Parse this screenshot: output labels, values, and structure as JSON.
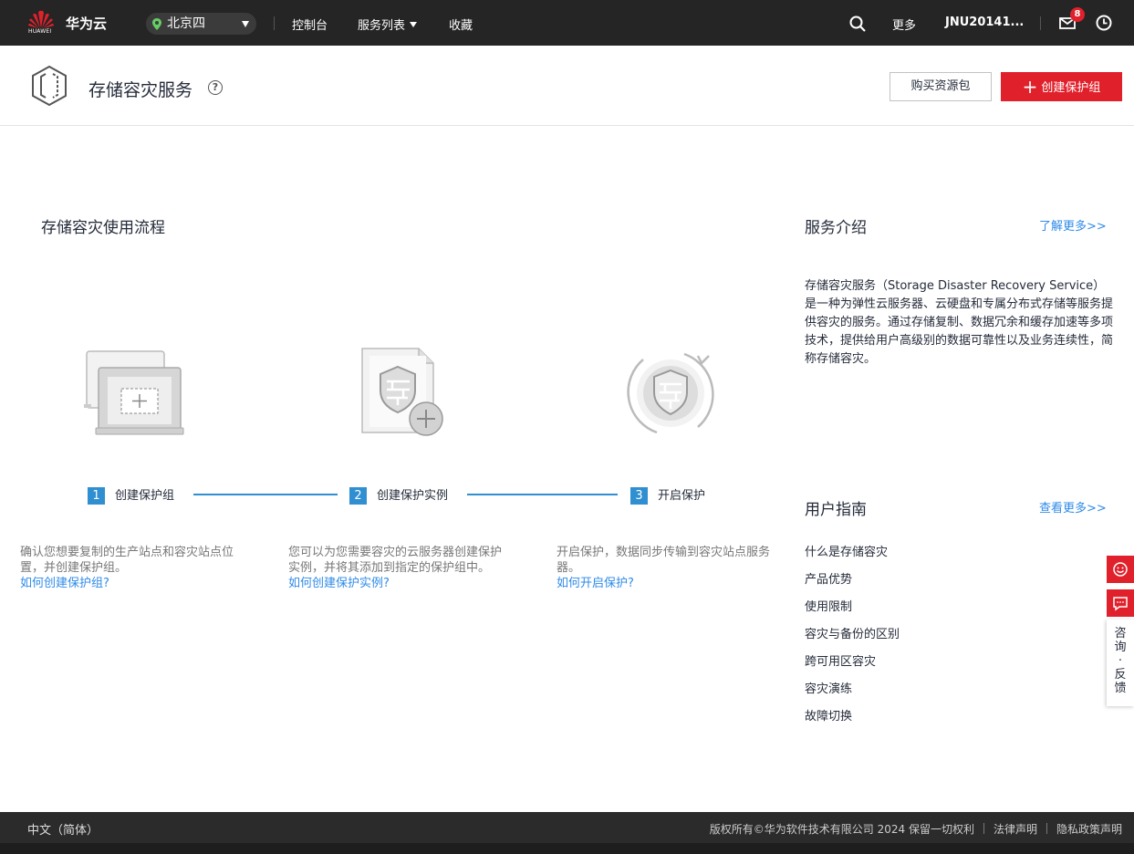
{
  "topbar": {
    "logo_text": "HUAWEI",
    "brand": "华为云",
    "region": "北京四",
    "nav": [
      "控制台",
      "服务列表",
      "收藏"
    ],
    "more": "更多",
    "user": "JNU20141...",
    "message_count": "8"
  },
  "header": {
    "title": "存储容灾服务",
    "help": "?",
    "buy_button": "购买资源包",
    "create_button": "创建保护组"
  },
  "process": {
    "title": "存储容灾使用流程",
    "steps": [
      {
        "num": "1",
        "label": "创建保护组",
        "desc": "确认您想要复制的生产站点和容灾站点位置，并创建保护组。",
        "link": "如何创建保护组?"
      },
      {
        "num": "2",
        "label": "创建保护实例",
        "desc": "您可以为您需要容灾的云服务器创建保护实例，并将其添加到指定的保护组中。",
        "link": "如何创建保护实例?"
      },
      {
        "num": "3",
        "label": "开启保护",
        "desc": "开启保护，数据同步传输到容灾站点服务器。",
        "link": "如何开启保护?"
      }
    ]
  },
  "intro": {
    "title": "服务介绍",
    "more": "了解更多>>",
    "text": "存储容灾服务（Storage Disaster Recovery Service）是一种为弹性云服务器、云硬盘和专属分布式存储等服务提供容灾的服务。通过存储复制、数据冗余和缓存加速等多项技术，提供给用户高级别的数据可靠性以及业务连续性，简称存储容灾。"
  },
  "guide": {
    "title": "用户指南",
    "more": "查看更多>>",
    "items": [
      "什么是存储容灾",
      "产品优势",
      "使用限制",
      "容灾与备份的区别",
      "跨可用区容灾",
      "容灾演练",
      "故障切换"
    ]
  },
  "float": {
    "chars": [
      "咨",
      "询",
      "·",
      "反",
      "馈"
    ]
  },
  "footer": {
    "lang": "中文（简体）",
    "copyright": "版权所有©华为软件技术有限公司 2024 保留一切权利",
    "legal": "法律声明",
    "privacy": "隐私政策声明"
  },
  "colors": {
    "brand_red": "#e0212b",
    "link_blue": "#2f8be8",
    "step_blue": "#2f8fd0",
    "topbar_bg": "#252525"
  }
}
